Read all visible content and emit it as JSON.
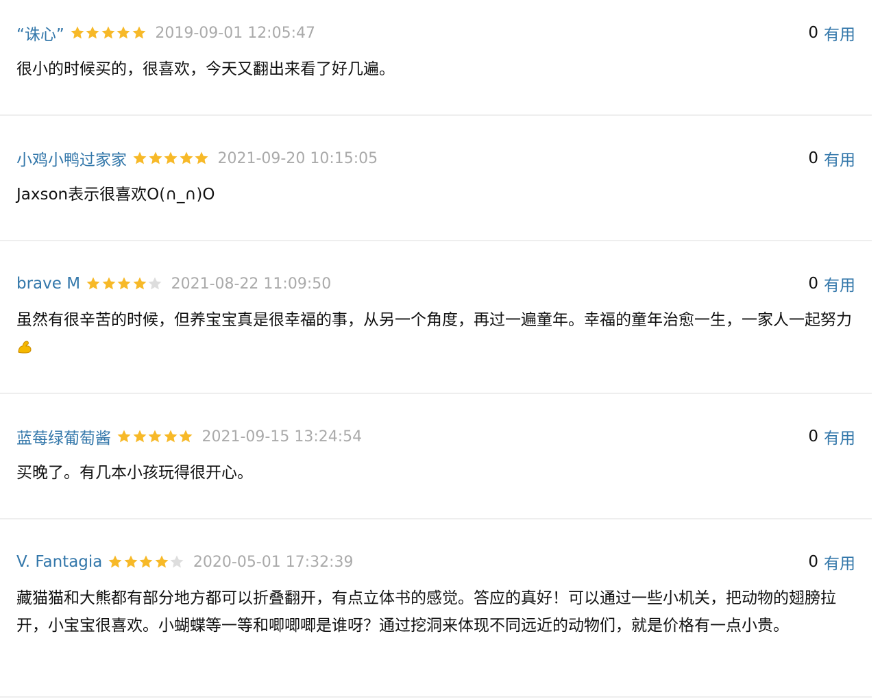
{
  "colors": {
    "link": "#3377aa",
    "meta": "#aaaaaa",
    "star_on": "#f7b928",
    "star_off": "#dddddd",
    "divider": "#eeeeee"
  },
  "icons": {
    "star": "star-icon",
    "muscle": "flexed-biceps-emoji"
  },
  "comments": [
    {
      "user": "“诛心”",
      "rating": 5,
      "time": "2019-09-01 12:05:47",
      "votes": "0",
      "vote_label": "有用",
      "text": "很小的时候买的，很喜欢，今天又翻出来看了好几遍。"
    },
    {
      "user": "小鸡小鸭过家家",
      "rating": 5,
      "time": "2021-09-20 10:15:05",
      "votes": "0",
      "vote_label": "有用",
      "text": "Jaxson表示很喜欢O(∩_∩)O"
    },
    {
      "user": "brave M",
      "rating": 4,
      "time": "2021-08-22 11:09:50",
      "votes": "0",
      "vote_label": "有用",
      "text": "虽然有很辛苦的时候，但养宝宝真是很幸福的事，从另一个角度，再过一遍童年。幸福的童年治愈一生，一家人一起努力"
    },
    {
      "user": "蓝莓绿葡萄酱",
      "rating": 5,
      "time": "2021-09-15 13:24:54",
      "votes": "0",
      "vote_label": "有用",
      "text": "买晚了。有几本小孩玩得很开心。"
    },
    {
      "user": "V. Fantagia",
      "rating": 4,
      "time": "2020-05-01 17:32:39",
      "votes": "0",
      "vote_label": "有用",
      "text": "藏猫猫和大熊都有部分地方都可以折叠翻开，有点立体书的感觉。答应的真好！可以通过一些小机关，把动物的翅膀拉开，小宝宝很喜欢。小蝴蝶等一等和唧唧唧是谁呀？通过挖洞来体现不同远近的动物们，就是价格有一点小贵。"
    }
  ]
}
